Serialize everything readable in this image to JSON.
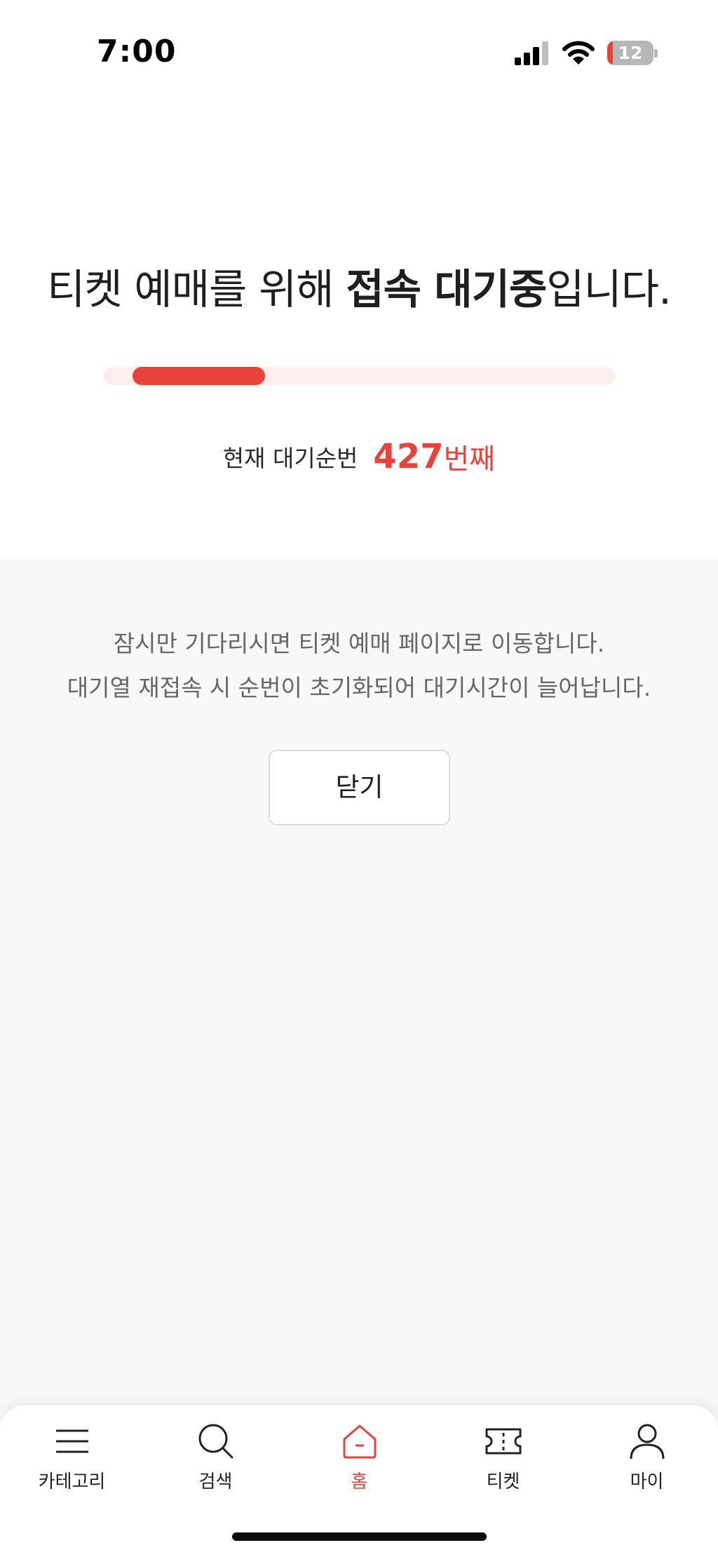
{
  "status_bar": {
    "time": "7:00",
    "battery_level": "12",
    "battery_fraction": 0.12
  },
  "headline": {
    "part1": "티켓 예매를 위해 ",
    "bold": "접속 대기중",
    "part2": "입니다."
  },
  "progress": {
    "fraction": 0.36
  },
  "queue": {
    "label": "현재 대기순번",
    "number": "427",
    "suffix": "번째"
  },
  "info": {
    "line1": "잠시만 기다리시면 티켓 예매 페이지로 이동합니다.",
    "line2": "대기열 재접속 시 순번이 초기화되어 대기시간이 늘어납니다."
  },
  "close_button": {
    "label": "닫기"
  },
  "bottom_nav": {
    "items": [
      {
        "label": "카테고리",
        "icon": "menu-icon"
      },
      {
        "label": "검색",
        "icon": "search-icon"
      },
      {
        "label": "홈",
        "icon": "home-icon",
        "active": true
      },
      {
        "label": "티켓",
        "icon": "ticket-icon"
      },
      {
        "label": "마이",
        "icon": "person-icon"
      }
    ]
  },
  "colors": {
    "accent": "#e9423a",
    "track": "#fdeeee",
    "background": "#f8f8f8"
  }
}
